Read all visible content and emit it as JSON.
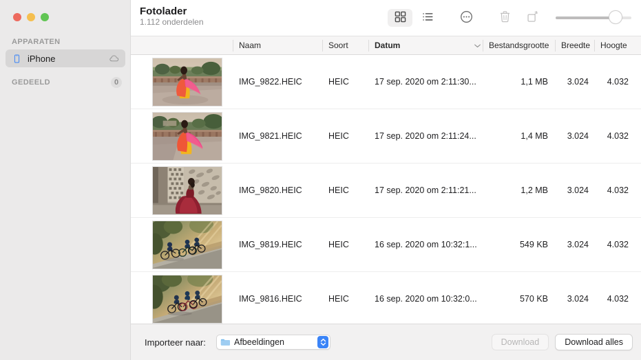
{
  "window": {
    "traffic_lights": [
      {
        "name": "close",
        "color": "#ed6a5e"
      },
      {
        "name": "minimize",
        "color": "#f5bf4f"
      },
      {
        "name": "maximize",
        "color": "#61c554"
      }
    ]
  },
  "sidebar": {
    "sections": [
      {
        "header": "APPARATEN",
        "badge": null
      },
      {
        "header": "GEDEELD",
        "badge": "0"
      }
    ],
    "items": [
      {
        "label": "iPhone",
        "icon": "iphone-icon",
        "trailing_icon": "cloud-icon",
        "selected": true
      }
    ]
  },
  "header": {
    "title": "Fotolader",
    "subtitle": "1.112 onderdelen"
  },
  "toolbar": {
    "buttons": [
      {
        "name": "grid-view",
        "icon": "grid-icon",
        "selected": true,
        "enabled": true
      },
      {
        "name": "list-view",
        "icon": "list-icon",
        "selected": false,
        "enabled": true
      },
      {
        "name": "more-options",
        "icon": "ellipsis-circle-icon",
        "selected": false,
        "enabled": true
      },
      {
        "name": "delete",
        "icon": "trash-icon",
        "selected": false,
        "enabled": false
      },
      {
        "name": "rotate",
        "icon": "rotate-icon",
        "selected": false,
        "enabled": false
      }
    ],
    "zoom_slider": {
      "name": "thumbnail-size-slider",
      "value": 80
    }
  },
  "table": {
    "columns": [
      {
        "key": "naam",
        "label": "Naam",
        "sorted": false,
        "align": "left"
      },
      {
        "key": "soort",
        "label": "Soort",
        "sorted": false,
        "align": "left"
      },
      {
        "key": "datum",
        "label": "Datum",
        "sorted": true,
        "align": "left"
      },
      {
        "key": "bestandsgrootte",
        "label": "Bestandsgrootte",
        "sorted": false,
        "align": "right"
      },
      {
        "key": "breedte",
        "label": "Breedte",
        "sorted": false,
        "align": "right"
      },
      {
        "key": "hoogte",
        "label": "Hoogte",
        "sorted": false,
        "align": "right"
      }
    ],
    "sort_indicator": "chevron-down-icon",
    "rows": [
      {
        "thumbnail": "woman-pink-sari-terrace",
        "naam": "IMG_9822.HEIC",
        "soort": "HEIC",
        "datum": "17 sep. 2020 om 2:11:30...",
        "bestandsgrootte": "1,1 MB",
        "breedte": "3.024",
        "hoogte": "4.032"
      },
      {
        "thumbnail": "woman-pink-sari-terrace",
        "naam": "IMG_9821.HEIC",
        "soort": "HEIC",
        "datum": "17 sep. 2020 om 2:11:24...",
        "bestandsgrootte": "1,4 MB",
        "breedte": "3.024",
        "hoogte": "4.032"
      },
      {
        "thumbnail": "woman-red-dress-jali-window",
        "naam": "IMG_9820.HEIC",
        "soort": "HEIC",
        "datum": "17 sep. 2020 om 2:11:21...",
        "bestandsgrootte": "1,2 MB",
        "breedte": "3.024",
        "hoogte": "4.032"
      },
      {
        "thumbnail": "cyclists-sunlit-road",
        "naam": "IMG_9819.HEIC",
        "soort": "HEIC",
        "datum": "16 sep. 2020 om 10:32:1...",
        "bestandsgrootte": "549 KB",
        "breedte": "3.024",
        "hoogte": "4.032"
      },
      {
        "thumbnail": "cyclists-sunlit-road",
        "naam": "IMG_9816.HEIC",
        "soort": "HEIC",
        "datum": "16 sep. 2020 om 10:32:0...",
        "bestandsgrootte": "570 KB",
        "breedte": "3.024",
        "hoogte": "4.032"
      }
    ]
  },
  "footer": {
    "import_label": "Importeer naar:",
    "import_destination": "Afbeeldingen",
    "import_icon": "folder-icon",
    "stepper_icon": "chevron-up-down-icon",
    "download_button": {
      "label": "Download",
      "enabled": false
    },
    "download_all_button": {
      "label": "Download alles",
      "enabled": true
    }
  },
  "colors": {
    "accent": "#3b84f7",
    "sidebar_bg": "#ebeaea",
    "header_bg": "#f6f5f5",
    "footer_bg": "#f2f1f1"
  }
}
